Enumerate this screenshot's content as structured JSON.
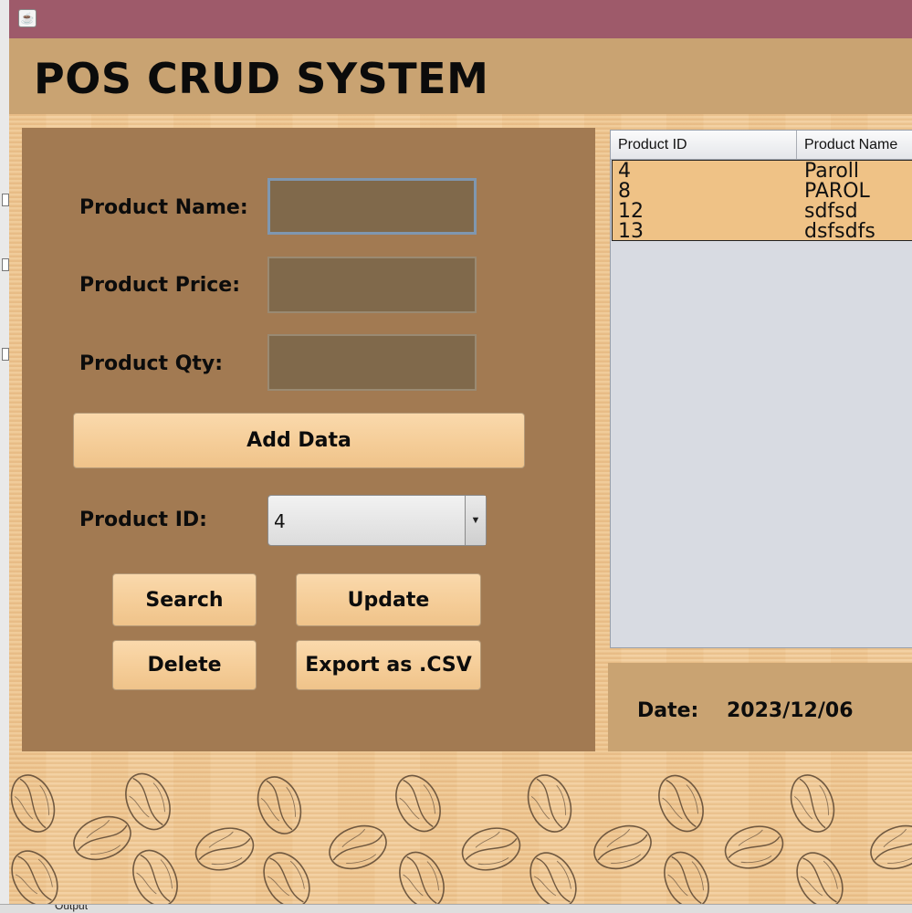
{
  "window": {
    "app_icon": "java-app-icon"
  },
  "header": {
    "title": "POS CRUD SYSTEM"
  },
  "form": {
    "product_name_label": "Product Name:",
    "product_price_label": "Product Price:",
    "product_qty_label": "Product Qty:",
    "product_name_value": "",
    "product_price_value": "",
    "product_qty_value": "",
    "add_button": "Add Data",
    "product_id_label": "Product ID:",
    "product_id_selected": "4",
    "search_button": "Search",
    "update_button": "Update",
    "delete_button": "Delete",
    "export_button": "Export as .CSV"
  },
  "table": {
    "columns": [
      "Product ID",
      "Product Name"
    ],
    "rows": [
      [
        "4",
        "Paroll"
      ],
      [
        "8",
        "PAROL"
      ],
      [
        "12",
        "sdfsd"
      ],
      [
        "13",
        "dsfsdfs"
      ]
    ]
  },
  "status": {
    "date_label": "Date:",
    "date_value": "2023/12/06"
  },
  "ide": {
    "output_tab": "Output"
  },
  "colors": {
    "titlebar": "#9e5a6a",
    "header": "#c9a372",
    "form_panel": "#a27a52",
    "field": "#80694b",
    "button": "#f5cd98",
    "table_body": "#efc286"
  }
}
